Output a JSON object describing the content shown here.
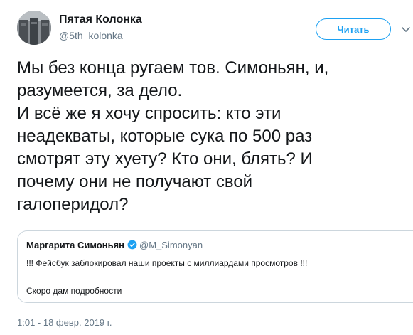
{
  "colors": {
    "text": "#14171a",
    "secondary": "#657786",
    "accent": "#1da1f2",
    "border": "#ccd6dd"
  },
  "author": {
    "name": "Пятая Колонка",
    "handle": "@5th_kolonka",
    "avatar_icon": "avatar-image"
  },
  "follow_button": {
    "label": "Читать"
  },
  "menu_icon": "chevron-down-icon",
  "tweet": {
    "lines": [
      "Мы без конца ругаем тов. Симоньян, и,",
      "разумеется, за дело.",
      "И всё же я хочу спросить: кто эти",
      "неадекваты, которые сука по 500 раз",
      "смотрят эту хуету? Кто они, блять? И",
      "почему они не получают свой",
      "галоперидол?"
    ]
  },
  "quoted_tweet": {
    "name": "Маргарита Симоньян",
    "verified_icon": "verified-badge-icon",
    "handle": "@M_Simonyan",
    "line1": "!!! Фейсбук заблокировал наши проекты с миллиардами просмотров !!!",
    "line2": "Скоро дам подробности"
  },
  "timestamp": "1:01 - 18 февр. 2019 г."
}
